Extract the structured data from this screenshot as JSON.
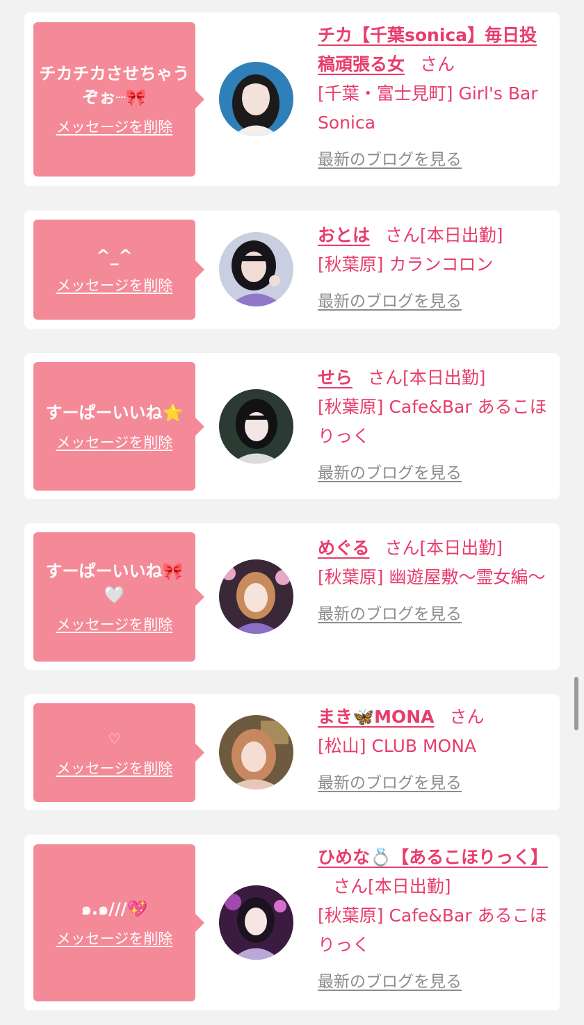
{
  "colors": {
    "bubble": "#f48a98",
    "accent": "#e83c6c",
    "link_gray": "#8c8c8c",
    "background": "#f2f2f2"
  },
  "cards": [
    {
      "message": "チカチカさせちゃうぞぉ┈🎀",
      "delete_label": "メッセージを削除",
      "name": "チカ【千葉sonica】毎日投稿頑張る女",
      "honorific": "さん",
      "status": "",
      "shop": "[千葉・富士見町] Girl's Bar Sonica",
      "blog_label": "最新のブログを見る"
    },
    {
      "message": "^_^",
      "delete_label": "メッセージを削除",
      "name": "おとは",
      "honorific": "さん",
      "status": "[本日出勤]",
      "shop": "[秋葉原] カランコロン",
      "blog_label": "最新のブログを見る"
    },
    {
      "message": "すーぱーいいね⭐️",
      "delete_label": "メッセージを削除",
      "name": "せら",
      "honorific": "さん",
      "status": "[本日出勤]",
      "shop": "[秋葉原] Cafe&Bar あるこほりっく",
      "blog_label": "最新のブログを見る"
    },
    {
      "message": "すーぱーいいね🎀🤍",
      "delete_label": "メッセージを削除",
      "name": "めぐる",
      "honorific": "さん",
      "status": "[本日出勤]",
      "shop": "[秋葉原] 幽遊屋敷〜霊女編〜",
      "blog_label": "最新のブログを見る"
    },
    {
      "message": "♡",
      "delete_label": "メッセージを削除",
      "name": "まき🦋MONA",
      "honorific": "さん",
      "status": "",
      "shop": "[松山] CLUB MONA",
      "blog_label": "最新のブログを見る"
    },
    {
      "message": "๑.๑///💖",
      "delete_label": "メッセージを削除",
      "name": "ひめな💍【あるこほりっく】",
      "honorific": "さん",
      "status": "[本日出勤]",
      "shop": "[秋葉原] Cafe&Bar あるこほりっく",
      "blog_label": "最新のブログを見る"
    }
  ]
}
